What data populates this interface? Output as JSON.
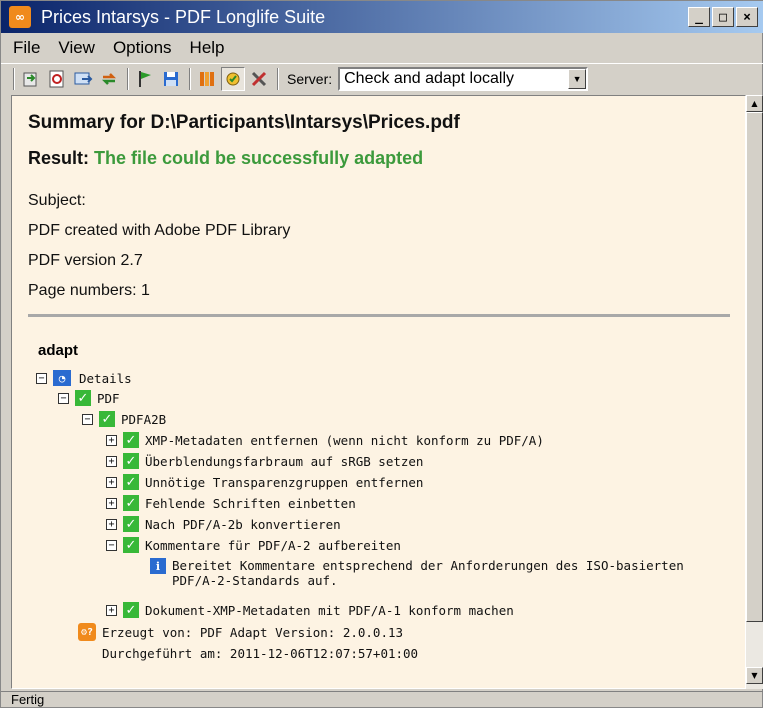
{
  "window": {
    "title": "Prices Intarsys - PDF Longlife Suite",
    "minimize": "_",
    "maximize": "□",
    "close": "×"
  },
  "menu": {
    "file": "File",
    "view": "View",
    "options": "Options",
    "help": "Help"
  },
  "toolbar": {
    "server_label": "Server:",
    "server_value": "Check and adapt locally",
    "buttons": [
      "open-icon",
      "pdf-icon",
      "export-icon",
      "refresh-icon",
      "flag-icon",
      "save-icon",
      "library-icon",
      "adapt-icon",
      "tools-icon"
    ]
  },
  "summary": {
    "title": "Summary for D:\\Participants\\Intarsys\\Prices.pdf",
    "result_label": "Result:",
    "result_value": "The file could be successfully adapted",
    "subject": "Subject:",
    "creator": "PDF created with Adobe PDF Library",
    "version": "PDF version 2.7",
    "pages": "Page numbers: 1"
  },
  "tree": {
    "section": "adapt",
    "details": "Details",
    "pdf": "PDF",
    "pdfa2b": "PDFA2B",
    "items": [
      "XMP-Metadaten entfernen (wenn nicht konform zu PDF/A)",
      "Überblendungsfarbraum auf sRGB setzen",
      "Unnötige Transparenzgruppen entfernen",
      "Fehlende Schriften einbetten",
      "Nach PDF/A-2b konvertieren",
      "Kommentare für PDF/A-2 aufbereiten"
    ],
    "info_line1": "Bereitet Kommentare entsprechend der Anforderungen des ISO-basierten",
    "info_line2": "PDF/A-2-Standards auf.",
    "last_item": "Dokument-XMP-Metadaten mit PDF/A-1 konform machen",
    "generated_by": "Erzeugt von: PDF Adapt Version: 2.0.0.13",
    "executed_at": "Durchgeführt am: 2011-12-06T12:07:57+01:00"
  },
  "status": {
    "text": "Fertig"
  },
  "colors": {
    "result_green": "#3c9a3c",
    "content_bg": "#fdf3e3",
    "check_green": "#38b838"
  }
}
